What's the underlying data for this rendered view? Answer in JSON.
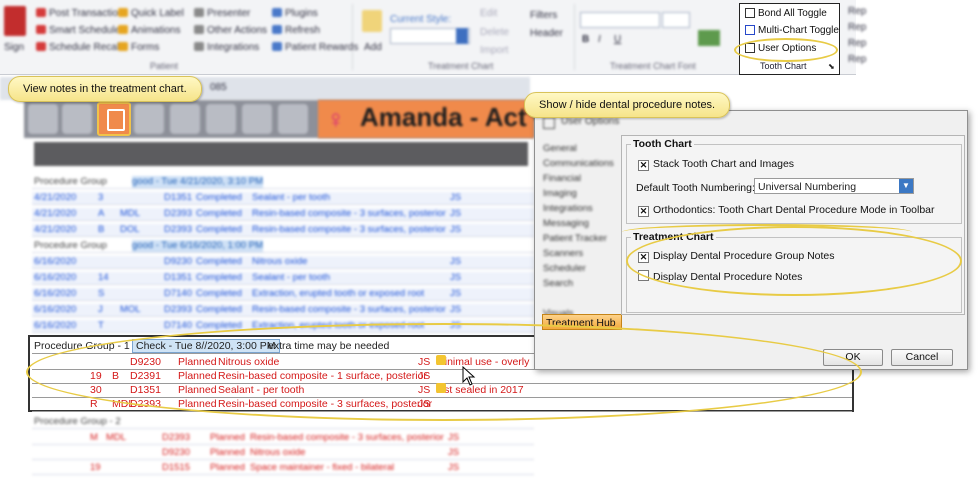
{
  "ribbon": {
    "patient_col1": [
      "Post Transaction",
      "Smart Scheduler",
      "Schedule Recall"
    ],
    "patient_col2": [
      "Quick Label",
      "Animations",
      "Forms"
    ],
    "patient_col3": [
      "Presenter",
      "Other Actions",
      "Integrations"
    ],
    "patient_col4": [
      "Plugins",
      "Refresh",
      "Patient Rewards"
    ],
    "patient_group": "Patient",
    "sign_in": "Sign",
    "current_style_label": "Current Style:",
    "add_label": "Add",
    "treatment_edit": [
      "Edit",
      "Delete",
      "Import"
    ],
    "treatment_view": [
      "Filters",
      "Header"
    ],
    "treatment_group": "Treatment Chart",
    "font_group": "Treatment Chart Font",
    "tooth_chart": {
      "items": [
        "Bond All Toggle",
        "Multi-Chart Toggle",
        "User Options"
      ],
      "group": "Tooth Chart"
    },
    "right_edge": [
      "Rep",
      "Rep",
      "Rep",
      "Rep"
    ]
  },
  "callouts": {
    "left": "View notes in the treatment chart.",
    "right": "Show / hide dental procedure notes."
  },
  "tab": {
    "label": "085"
  },
  "patient_banner": {
    "name": "Amanda - Act -"
  },
  "history": {
    "groups": [
      {
        "label": "Procedure Group",
        "tag": "good - Tue 4/21/2020, 3:10 PM"
      },
      {
        "label": "Procedure Group",
        "tag": "good - Tue 6/16/2020, 1:00 PM"
      }
    ],
    "completed_a": [
      [
        "4/21/2020",
        "3",
        "",
        "D1351",
        "Completed",
        "Sealant - per tooth",
        "JS"
      ],
      [
        "4/21/2020",
        "A",
        "MDL",
        "D2393",
        "Completed",
        "Resin-based composite - 3 surfaces, posterior",
        "JS"
      ],
      [
        "4/21/2020",
        "B",
        "DOL",
        "D2393",
        "Completed",
        "Resin-based composite - 3 surfaces, posterior",
        "JS"
      ]
    ],
    "completed_b": [
      [
        "6/16/2020",
        "",
        "",
        "D9230",
        "Completed",
        "Nitrous oxide",
        "JS"
      ],
      [
        "6/16/2020",
        "14",
        "",
        "D1351",
        "Completed",
        "Sealant - per tooth",
        "JS"
      ],
      [
        "6/16/2020",
        "S",
        "",
        "D7140",
        "Completed",
        "Extraction, erupted tooth or exposed root",
        "JS"
      ],
      [
        "6/16/2020",
        "J",
        "MOL",
        "D2393",
        "Completed",
        "Resin-based composite - 3 surfaces, posterior",
        "JS"
      ],
      [
        "6/16/2020",
        "T",
        "",
        "D7140",
        "Completed",
        "Extraction, erupted tooth or exposed root",
        "JS"
      ]
    ]
  },
  "focus_group": {
    "label": "Procedure Group - 1",
    "check": "Check - Tue 8/",
    "check_rest": "/2020, 3:00 PM",
    "note": "extra time may be needed",
    "rows": [
      {
        "tooth": "",
        "surf": "",
        "code": "D9230",
        "status": "Planned",
        "desc": "Nitrous oxide",
        "prov": "JS",
        "note": "minimal use - overly"
      },
      {
        "tooth": "19",
        "surf": "B",
        "code": "D2391",
        "status": "Planned",
        "desc": "Resin-based composite - 1 surface, posterior",
        "prov": "JS",
        "note": ""
      },
      {
        "tooth": "30",
        "surf": "",
        "code": "D1351",
        "status": "Planned",
        "desc": "Sealant - per tooth",
        "prov": "JS",
        "note": "last sealed in 2017"
      },
      {
        "tooth": "R",
        "surf": "MDL",
        "code": "D2393",
        "status": "Planned",
        "desc": "Resin-based composite - 3 surfaces, posterior",
        "prov": "JS",
        "note": ""
      }
    ]
  },
  "bottom_group": {
    "label": "Procedure Group - 2",
    "rows": [
      [
        "M",
        "MDL",
        "D2393",
        "Planned",
        "Resin-based composite - 3 surfaces, posterior",
        "JS"
      ],
      [
        "",
        "",
        "D9230",
        "Planned",
        "Nitrous oxide",
        "JS"
      ],
      [
        "19",
        "",
        "D1515",
        "Planned",
        "Space maintainer - fixed - bilateral",
        "JS"
      ]
    ]
  },
  "dialog": {
    "title": "User Options",
    "sidebar": [
      "General",
      "Communications",
      "Financial",
      "Imaging",
      "Integrations",
      "Messaging",
      "Patient Tracker",
      "Scanners",
      "Scheduler",
      "Search",
      "Treatment Hub",
      "Visuals"
    ],
    "active_item": "Treatment Hub",
    "tooth_chart": {
      "legend": "Tooth Chart",
      "stack_label": "Stack Tooth Chart and Images",
      "stack_checked": true,
      "numbering_label": "Default Tooth Numbering:",
      "numbering_value": "Universal Numbering",
      "ortho_label": "Orthodontics: Tooth Chart Dental Procedure Mode in Toolbar",
      "ortho_checked": true
    },
    "treatment_chart": {
      "legend": "Treatment Chart",
      "group_notes_label": "Display Dental Procedure Group Notes",
      "group_notes_checked": true,
      "notes_label": "Display Dental Procedure Notes",
      "notes_checked": false
    },
    "ok": "OK",
    "cancel": "Cancel"
  }
}
